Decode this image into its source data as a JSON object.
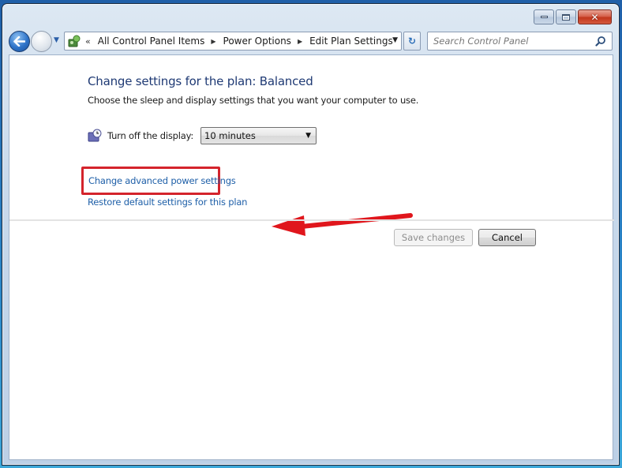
{
  "window": {
    "caption_buttons": {
      "minimize_icon": "minimize-icon",
      "maximize_icon": "maximize-icon",
      "close_icon": "close-icon",
      "close_glyph": "✕"
    }
  },
  "nav": {
    "back_icon": "back-arrow-icon",
    "forward_icon": "forward-arrow-icon",
    "recent_icon": "chevron-down-icon",
    "recent_glyph": "▼",
    "address": {
      "icon": "control-panel-icon",
      "overflow_glyph": "«",
      "crumbs": [
        "All Control Panel Items",
        "Power Options",
        "Edit Plan Settings"
      ],
      "separator_glyph": "▶",
      "dropdown_glyph": "▼"
    },
    "refresh_glyph": "↻",
    "search": {
      "placeholder": "Search Control Panel",
      "value": ""
    }
  },
  "main": {
    "title": "Change settings for the plan: Balanced",
    "subtitle": "Choose the sleep and display settings that you want your computer to use.",
    "display_setting": {
      "icon": "display-timer-icon",
      "label": "Turn off the display:",
      "selected": "10 minutes",
      "arrow_glyph": "▼"
    },
    "links": {
      "advanced": "Change advanced power settings",
      "restore": "Restore default settings for this plan"
    },
    "annotation": {
      "highlight_color": "#d4242c",
      "arrow_color": "#e0161c"
    },
    "buttons": {
      "save": "Save changes",
      "save_enabled": false,
      "cancel": "Cancel"
    }
  }
}
